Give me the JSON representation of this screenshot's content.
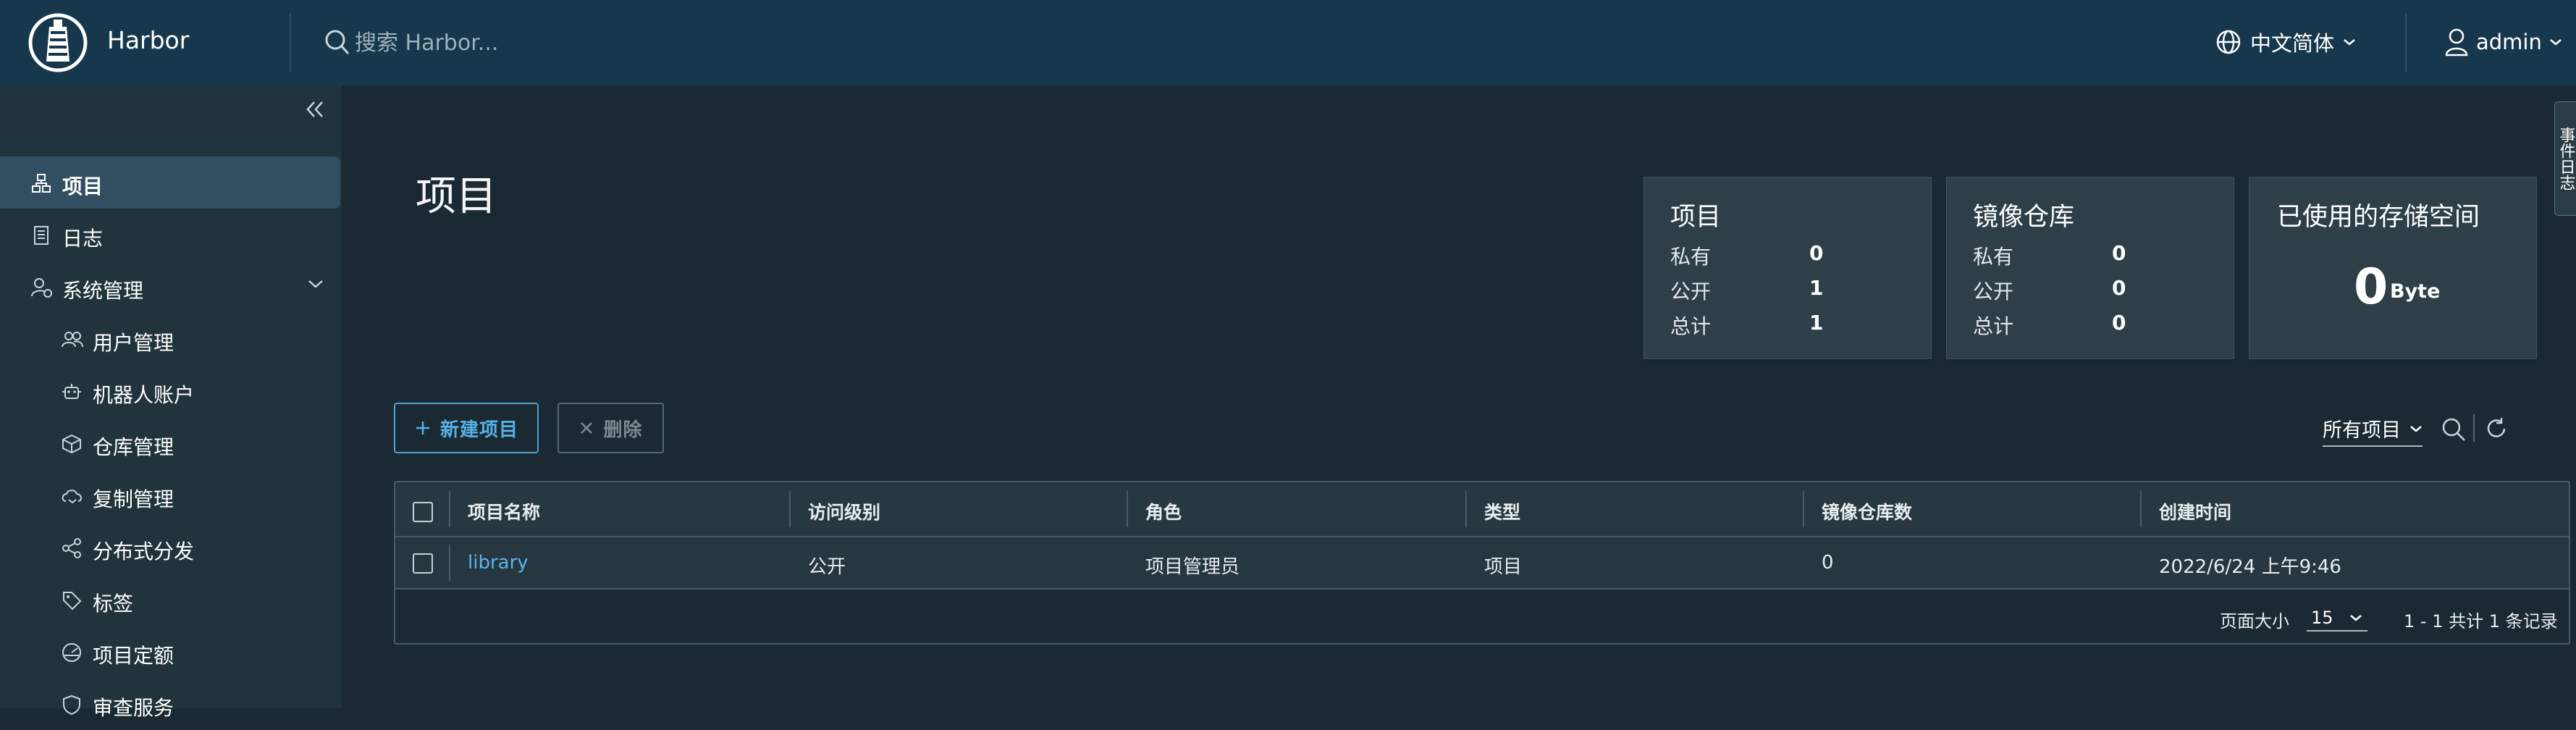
{
  "header": {
    "brand": "Harbor",
    "search_placeholder": "搜索 Harbor...",
    "language": "中文简体",
    "user": "admin"
  },
  "sidebar": {
    "items": [
      {
        "label": "项目",
        "icon": "projects-icon",
        "active": true
      },
      {
        "label": "日志",
        "icon": "logs-icon"
      },
      {
        "label": "系统管理",
        "icon": "system-admin-icon",
        "expanded": true
      },
      {
        "label": "用户管理",
        "icon": "users-icon"
      },
      {
        "label": "机器人账户",
        "icon": "robot-icon"
      },
      {
        "label": "仓库管理",
        "icon": "registries-icon"
      },
      {
        "label": "复制管理",
        "icon": "replications-icon"
      },
      {
        "label": "分布式分发",
        "icon": "distribution-icon"
      },
      {
        "label": "标签",
        "icon": "labels-icon"
      },
      {
        "label": "项目定额",
        "icon": "quotas-icon"
      },
      {
        "label": "审查服务",
        "icon": "interrogation-icon"
      }
    ]
  },
  "main": {
    "title": "项目",
    "cards": {
      "projects": {
        "title": "项目",
        "rows": [
          {
            "label": "私有",
            "value": "0"
          },
          {
            "label": "公开",
            "value": "1"
          },
          {
            "label": "总计",
            "value": "1"
          }
        ]
      },
      "repositories": {
        "title": "镜像仓库",
        "rows": [
          {
            "label": "私有",
            "value": "0"
          },
          {
            "label": "公开",
            "value": "0"
          },
          {
            "label": "总计",
            "value": "0"
          }
        ]
      },
      "storage": {
        "title": "已使用的存储空间",
        "value": "0",
        "unit": "Byte"
      }
    },
    "side_tab": "事件日志",
    "buttons": {
      "new_project": "新建项目",
      "delete": "删除"
    },
    "filter": {
      "selected": "所有项目"
    },
    "table": {
      "columns": [
        "项目名称",
        "访问级别",
        "角色",
        "类型",
        "镜像仓库数",
        "创建时间"
      ],
      "rows": [
        {
          "name": "library",
          "access": "公开",
          "role": "项目管理员",
          "type": "项目",
          "repo_count": "0",
          "created": "2022/6/24 上午9:46"
        }
      ],
      "footer": {
        "page_size_label": "页面大小",
        "page_size": "15",
        "summary": "1 - 1 共计 1 条记录"
      }
    }
  },
  "colors": {
    "header_bg": "#17384c",
    "sidebar_bg": "#21333b",
    "content_bg": "#1b2a32",
    "accent": "#55b1e8"
  }
}
